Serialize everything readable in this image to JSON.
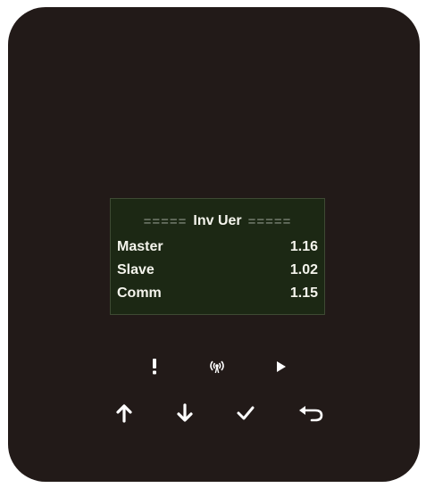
{
  "screen": {
    "title_rule_left": "=====",
    "title": "Inv Uer",
    "title_rule_right": "=====",
    "rows": [
      {
        "label": "Master",
        "value": "1.16"
      },
      {
        "label": "Slave",
        "value": "1.02"
      },
      {
        "label": "Comm",
        "value": "1.15"
      }
    ]
  },
  "indicators": [
    "alarm-icon",
    "wireless-signal-icon",
    "run-play-icon"
  ],
  "buttons": [
    "up-arrow-icon",
    "down-arrow-icon",
    "check-icon",
    "return-icon"
  ],
  "colors": {
    "device_body": "#221a18",
    "screen_bg": "#1c2814",
    "screen_text": "#f4f4ec",
    "icon": "#ffffff"
  }
}
